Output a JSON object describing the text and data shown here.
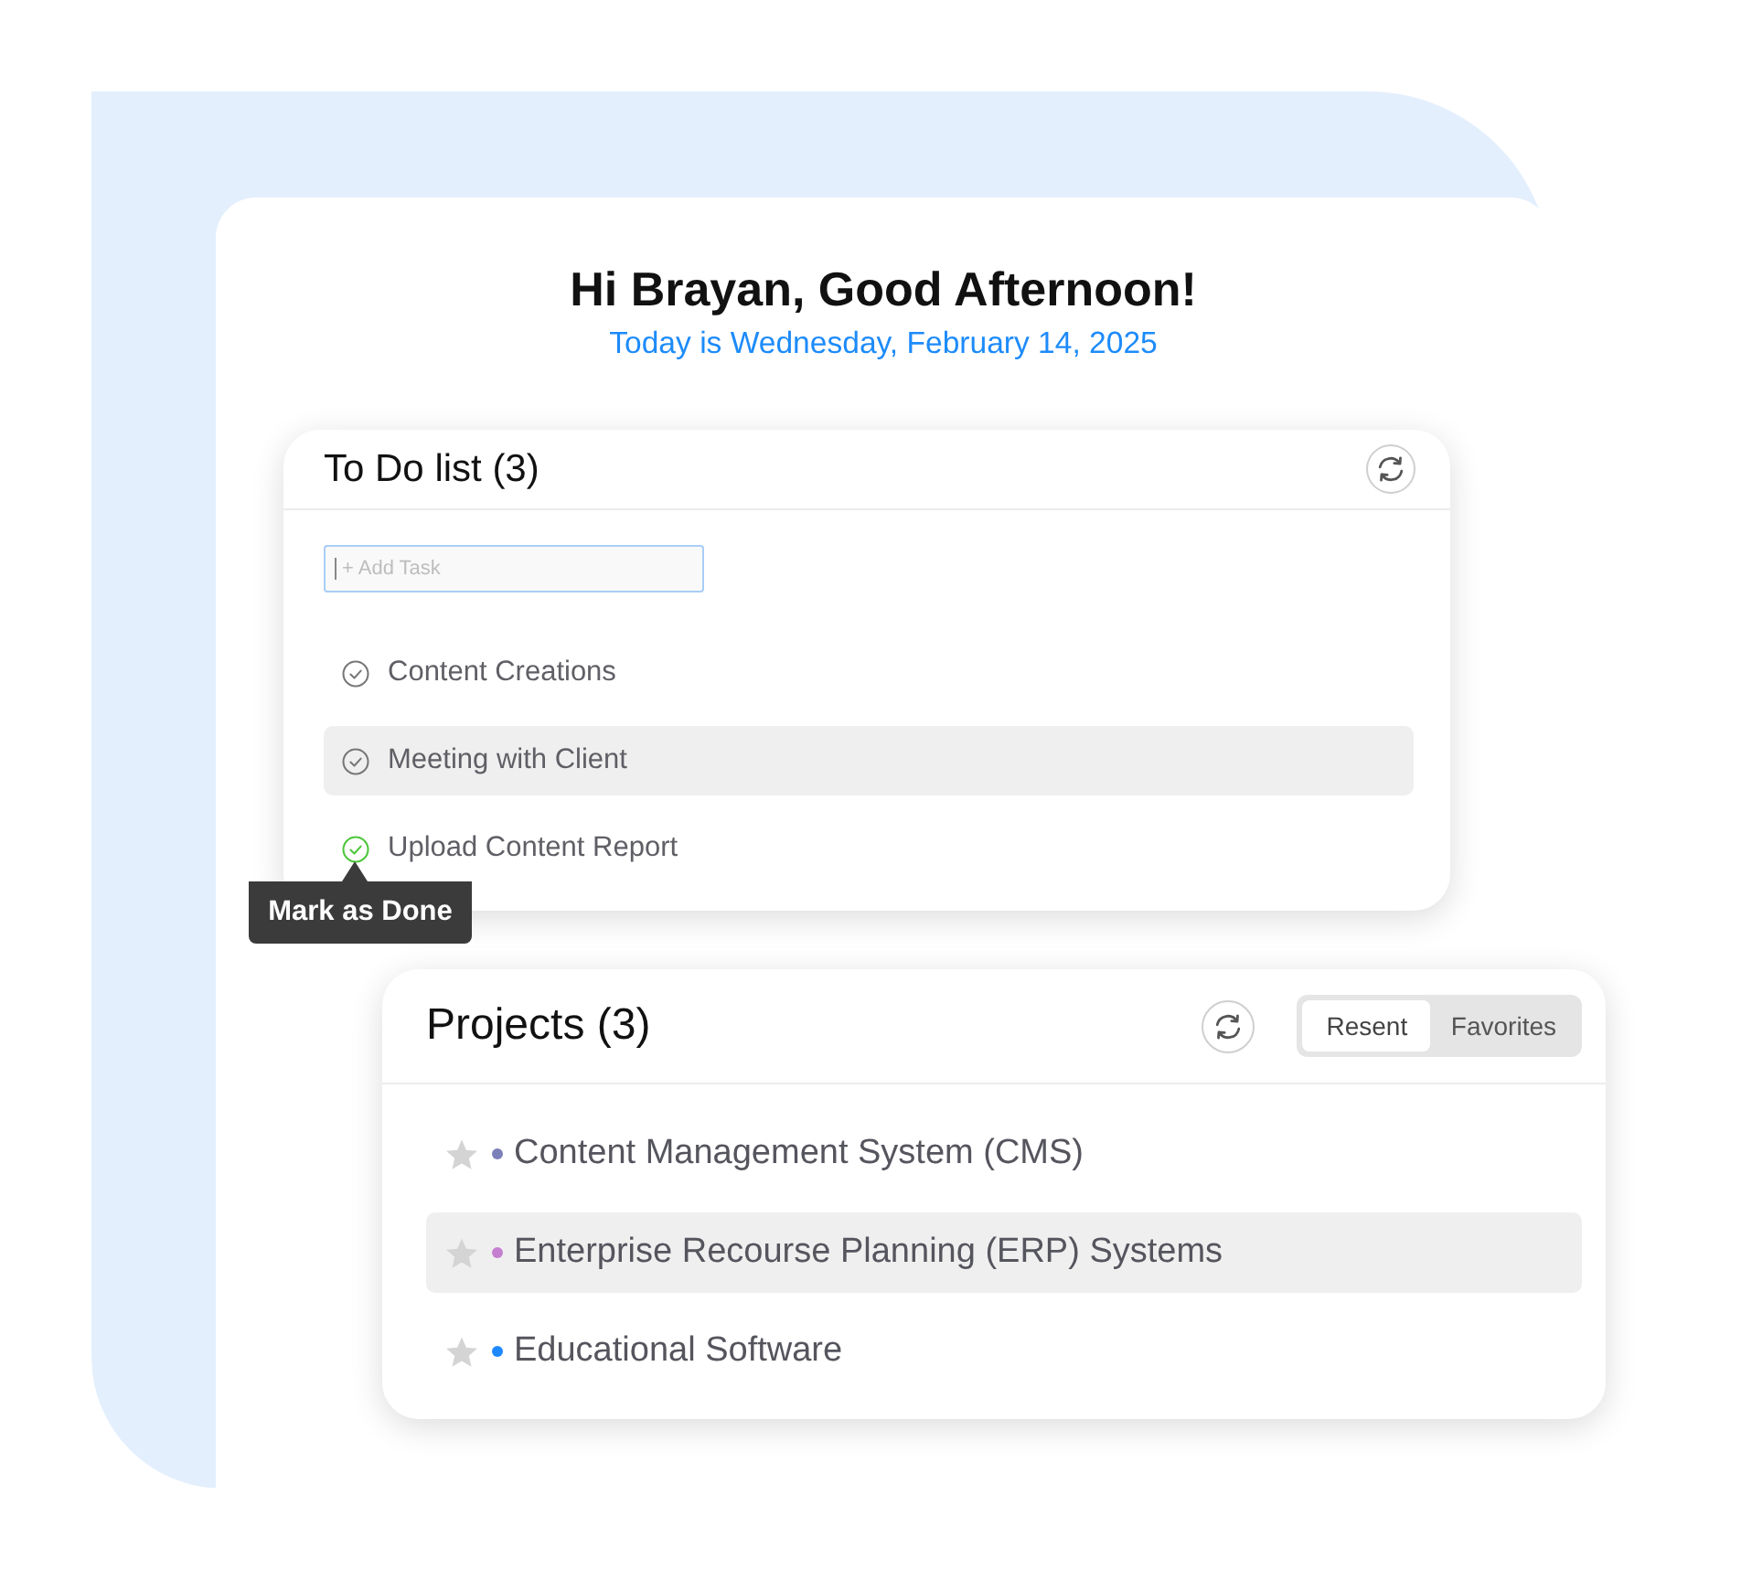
{
  "greeting": {
    "title": "Hi Brayan, Good Afternoon!",
    "date": "Today is Wednesday, February 14, 2025"
  },
  "todo": {
    "title": "To Do list (3)",
    "add_task": {
      "placeholder": "+ Add Task",
      "focused": true
    },
    "tasks": [
      {
        "label": "Content Creations",
        "highlighted": false,
        "check_hovered": false
      },
      {
        "label": "Meeting with Client",
        "highlighted": true,
        "check_hovered": false
      },
      {
        "label": "Upload Content Report",
        "highlighted": false,
        "check_hovered": true,
        "tooltip": "Mark as Done"
      }
    ]
  },
  "projects": {
    "title": "Projects (3)",
    "tabs": [
      {
        "label": "Resent",
        "selected": true
      },
      {
        "label": "Favorites",
        "selected": false
      }
    ],
    "items": [
      {
        "name": "Content Management System (CMS)",
        "color": "#7b80b8",
        "highlighted": false,
        "starred": false
      },
      {
        "name": "Enterprise Recourse Planning (ERP) Systems",
        "color": "#c57fd0",
        "highlighted": true,
        "starred": false
      },
      {
        "name": "Educational Software",
        "color": "#1e88ff",
        "highlighted": false,
        "starred": false
      }
    ]
  }
}
